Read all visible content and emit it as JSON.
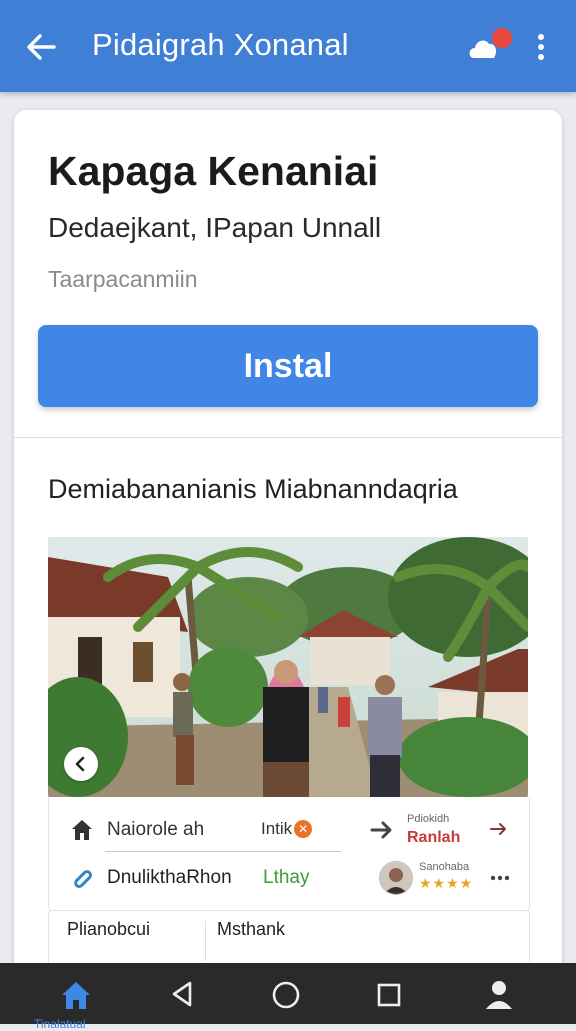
{
  "appbar": {
    "title": "Pidaigrah Xonanal",
    "back_icon": "arrow-left-icon",
    "notification_icon": "cloud-bell-icon",
    "more_icon": "more-vertical-icon",
    "bg_color": "#3f7fd6"
  },
  "app": {
    "title": "Kapaga Kenaniai",
    "subtitle": "Dedaejkant, IPapan Unnall",
    "meta": "Taarpacanmiin",
    "install_label": "Instal",
    "accent_color": "#3f86e6"
  },
  "section": {
    "title": "Demiabananianis Miabnanndaqria"
  },
  "info": {
    "row1": {
      "location_label": "Naiorole ah",
      "status_label": "Intik",
      "status_badge": "✕",
      "rating_caption": "Pdiokidh",
      "rating_text": "Ranlah"
    },
    "row2": {
      "link_label": "DnulikthaRhon",
      "tag_label": "Lthay",
      "review_caption": "Sanohaba",
      "stars": "★★★★"
    }
  },
  "bottom": {
    "left_label": "Plianobcui",
    "right_label": "Msthank"
  },
  "navbar": {
    "home_label": "Tinalatual",
    "icons": [
      "home-icon",
      "back-triangle-icon",
      "circle-home-icon",
      "square-recents-icon",
      "profile-icon"
    ]
  }
}
